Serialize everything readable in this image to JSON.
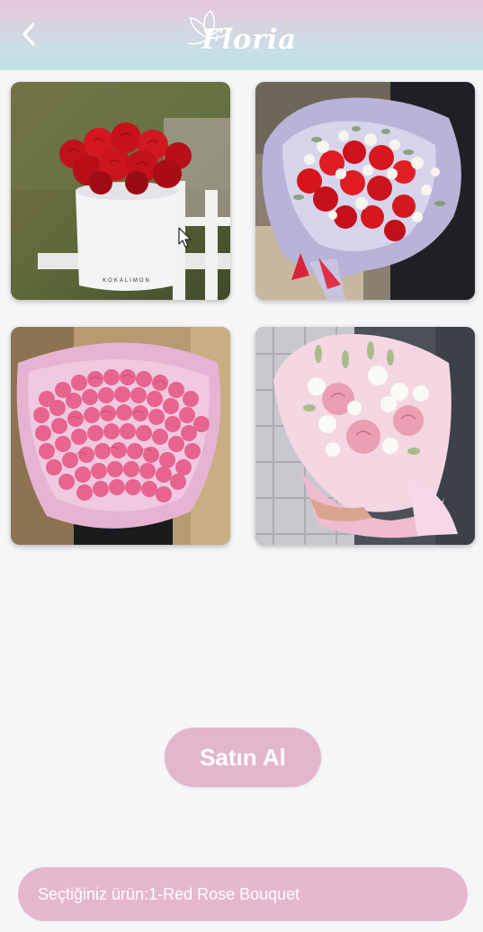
{
  "app": {
    "logo_text": "Floria"
  },
  "header": {
    "back_icon": "chevron-left-icon"
  },
  "products": [
    {
      "id": 1,
      "image": "red-roses-box"
    },
    {
      "id": 2,
      "image": "red-white-bouquet"
    },
    {
      "id": 3,
      "image": "pink-roses-bouquet"
    },
    {
      "id": 4,
      "image": "pink-rose-lisianthus-bouquet"
    }
  ],
  "actions": {
    "buy_label": "Satın Al"
  },
  "status": {
    "selected_message": "Seçtiğiniz ürün:1-Red Rose Bouquet"
  },
  "colors": {
    "accent": "#e4b6cb",
    "header_top": "#e8c6da",
    "header_bottom": "#bfe3e3"
  }
}
